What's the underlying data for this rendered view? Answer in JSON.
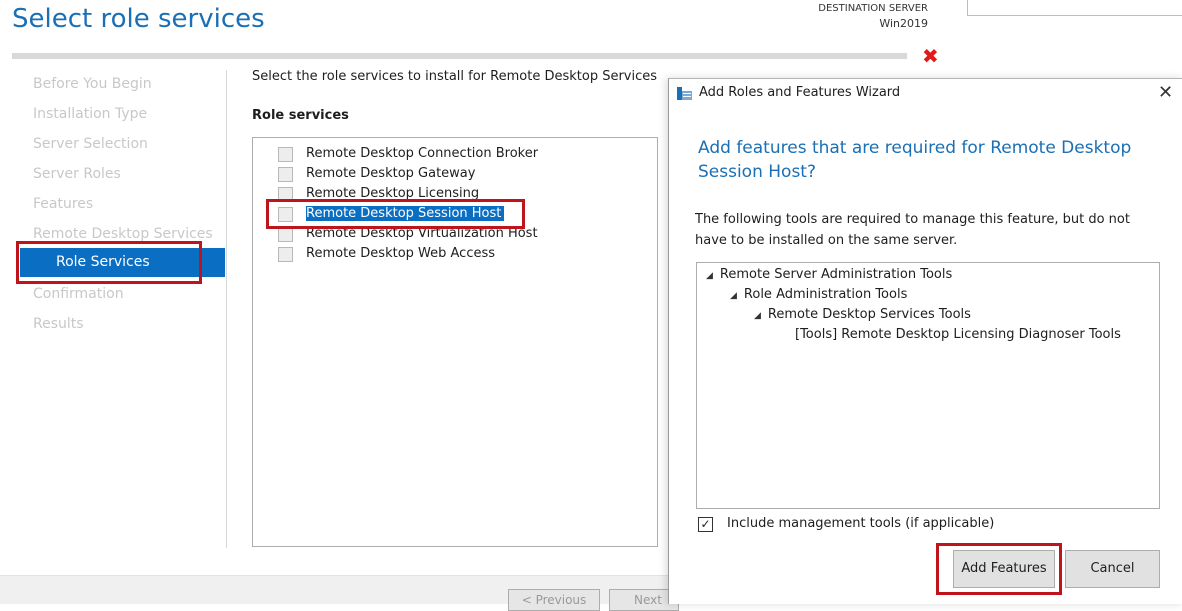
{
  "page": {
    "title": "Select role services",
    "destination_label": "DESTINATION SERVER",
    "destination_name": "Win2019",
    "error_icon": "close-x-icon",
    "accent_color": "#0a6fc2",
    "highlight_color": "#c0141c"
  },
  "nav": {
    "items": [
      {
        "label": "Before You Begin"
      },
      {
        "label": "Installation Type"
      },
      {
        "label": "Server Selection"
      },
      {
        "label": "Server Roles"
      },
      {
        "label": "Features"
      },
      {
        "label": "Remote Desktop Services"
      },
      {
        "label": "Role Services",
        "active": true
      },
      {
        "label": "Confirmation"
      },
      {
        "label": "Results"
      }
    ]
  },
  "content": {
    "instruction": "Select the role services to install for Remote Desktop Services",
    "role_services_label": "Role services",
    "services": [
      {
        "label": "Remote Desktop Connection Broker",
        "checked": false
      },
      {
        "label": "Remote Desktop Gateway",
        "checked": false
      },
      {
        "label": "Remote Desktop Licensing",
        "checked": false
      },
      {
        "label": "Remote Desktop Session Host",
        "checked": false,
        "selected": true
      },
      {
        "label": "Remote Desktop Virtualization Host",
        "checked": false
      },
      {
        "label": "Remote Desktop Web Access",
        "checked": false
      }
    ]
  },
  "footer": {
    "previous_label": "< Previous",
    "next_label": "Next"
  },
  "dialog": {
    "title": "Add Roles and Features Wizard",
    "close_icon": "close-icon",
    "heading": "Add features that are required for Remote Desktop Session Host?",
    "description": "The following tools are required to manage this feature, but do not have to be installed on the same server.",
    "tree": [
      {
        "label": "Remote Server Administration Tools",
        "expanded": true
      },
      {
        "label": "Role Administration Tools",
        "expanded": true
      },
      {
        "label": "Remote Desktop Services Tools",
        "expanded": true
      },
      {
        "label": "[Tools] Remote Desktop Licensing Diagnoser Tools",
        "expanded": false
      }
    ],
    "include_tools_label": "Include management tools (if applicable)",
    "include_tools_checked": true,
    "check_mark": "✓",
    "tree_toggle_glyph": "◢",
    "add_features_label": "Add Features",
    "cancel_label": "Cancel"
  }
}
